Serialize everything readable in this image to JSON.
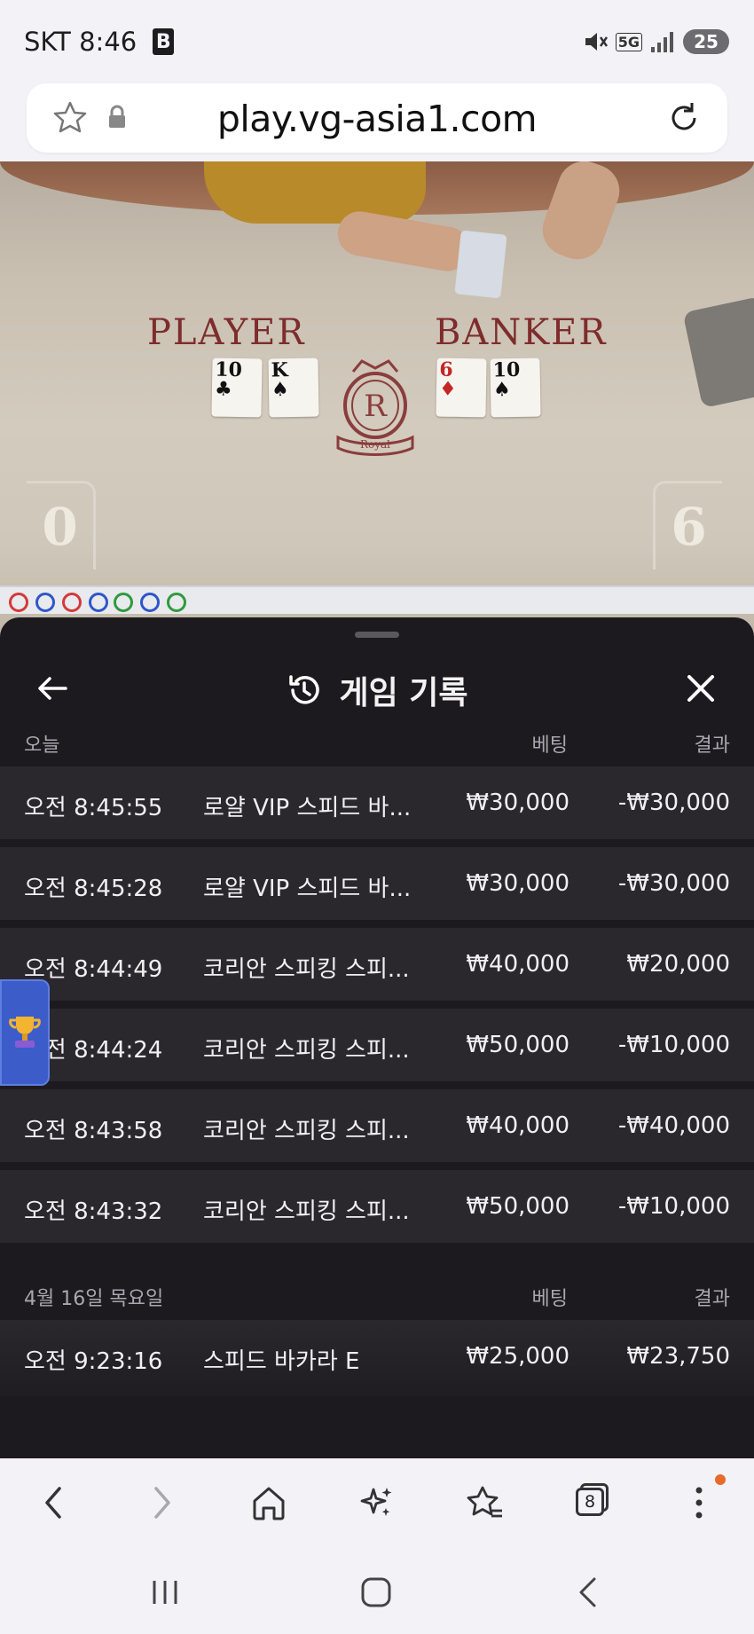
{
  "status_bar": {
    "carrier_time": "SKT 8:46",
    "app_badge": "B",
    "network": "5G",
    "battery": "25"
  },
  "browser": {
    "url": "play.vg-asia1.com",
    "tab_count": "8"
  },
  "game": {
    "player_label": "PLAYER",
    "banker_label": "BANKER",
    "player_cards": [
      {
        "rank": "10",
        "suit": "♣",
        "color": "black"
      },
      {
        "rank": "K",
        "suit": "♠",
        "color": "black"
      }
    ],
    "banker_cards": [
      {
        "rank": "6",
        "suit": "♦",
        "color": "red"
      },
      {
        "rank": "10",
        "suit": "♠",
        "color": "black"
      }
    ],
    "crest_letter": "R",
    "crest_text": "Royal",
    "player_score": "0",
    "banker_score": "6"
  },
  "history": {
    "title": "게임 기록",
    "sections": [
      {
        "date": "오늘",
        "bet_header": "베팅",
        "result_header": "결과",
        "rows": [
          {
            "time": "오전 8:45:55",
            "game": "로얄 VIP 스피드 바...",
            "bet": "₩30,000",
            "result": "-₩30,000"
          },
          {
            "time": "오전 8:45:28",
            "game": "로얄 VIP 스피드 바...",
            "bet": "₩30,000",
            "result": "-₩30,000"
          },
          {
            "time": "오전 8:44:49",
            "game": "코리안 스피킹 스피...",
            "bet": "₩40,000",
            "result": "₩20,000"
          },
          {
            "time": "오전 8:44:24",
            "game": "코리안 스피킹 스피...",
            "bet": "₩50,000",
            "result": "-₩10,000"
          },
          {
            "time": "오전 8:43:58",
            "game": "코리안 스피킹 스피...",
            "bet": "₩40,000",
            "result": "-₩40,000"
          },
          {
            "time": "오전 8:43:32",
            "game": "코리안 스피킹 스피...",
            "bet": "₩50,000",
            "result": "-₩10,000"
          }
        ]
      },
      {
        "date": "4월 16일 목요일",
        "bet_header": "베팅",
        "result_header": "결과",
        "rows": [
          {
            "time": "오전 9:23:16",
            "game": "스피드 바카라 E",
            "bet": "₩25,000",
            "result": "₩23,750"
          }
        ]
      }
    ]
  },
  "colors": {
    "sheet_bg": "#1c1a1e",
    "row_bg": "#2a282d",
    "accent_red": "#7e2c2c",
    "notification": "#e86b2c"
  }
}
